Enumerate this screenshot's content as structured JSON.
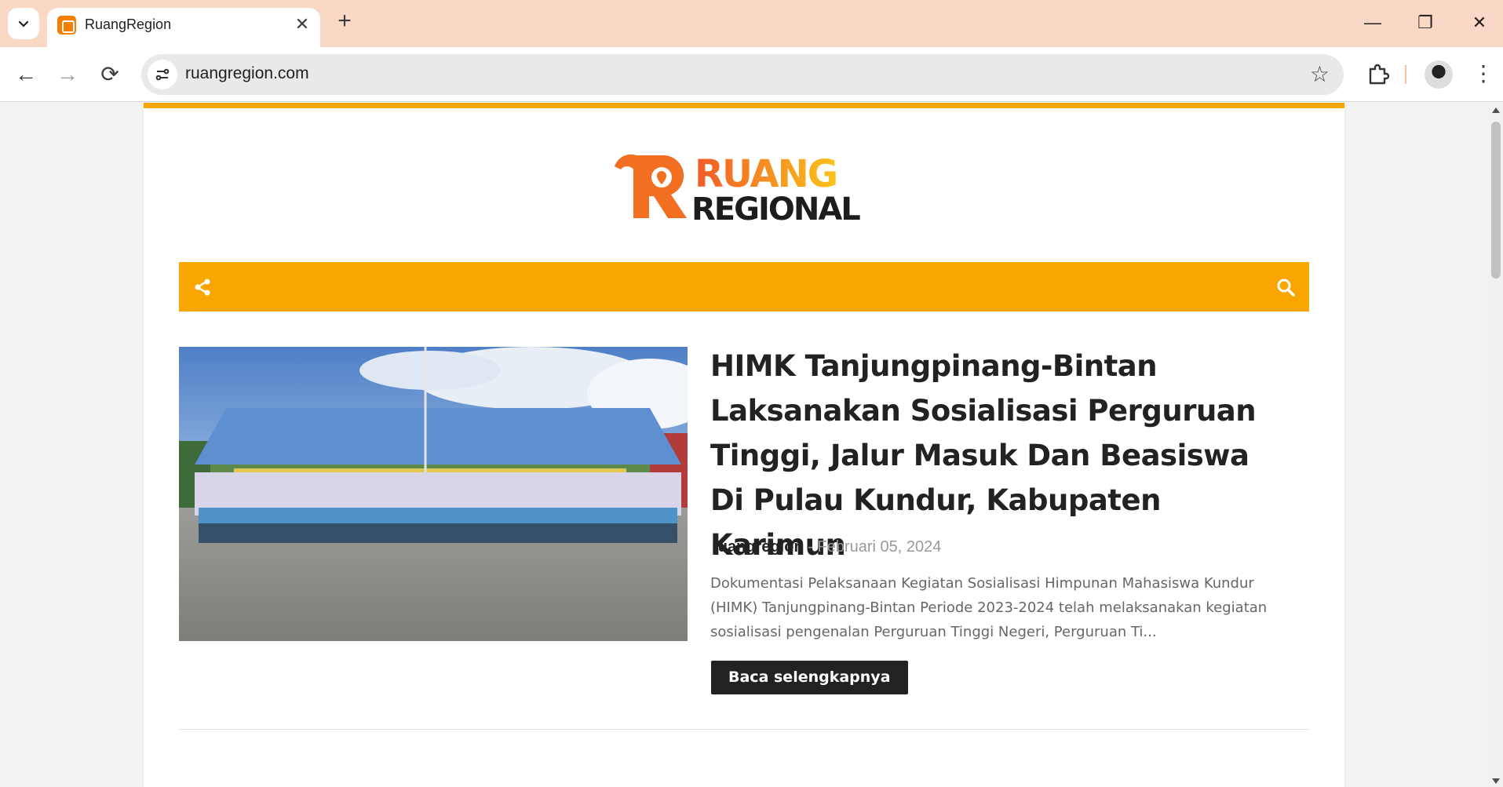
{
  "browser": {
    "tab_title": "RuangRegion",
    "url": "ruangregion.com",
    "new_tab_glyph": "+",
    "close_tab_glyph": "✕",
    "back_glyph": "←",
    "forward_glyph": "→",
    "reload_glyph": "⟳",
    "star_glyph": "☆",
    "menu_glyph": "⋮",
    "minimize_glyph": "—",
    "restore_glyph": "❐",
    "close_glyph": "✕"
  },
  "site": {
    "logo_top": "RUANG",
    "logo_bottom": "REGIONAL",
    "accent_color": "#f9a602"
  },
  "post": {
    "title": "HIMK Tanjungpinang-Bintan Laksanakan Sosialisasi Perguruan Tinggi, Jalur Masuk Dan Beasiswa Di Pulau Kundur, Kabupaten Karimun",
    "author": "ruangregion",
    "separator": " - ",
    "date": "Februari 05, 2024",
    "excerpt": "Dokumentasi Pelaksanaan Kegiatan Sosialisasi Himpunan Mahasiswa Kundur (HIMK) Tanjungpinang-Bintan Periode 2023-2024 telah melaksanakan kegiatan sosialisasi pengenalan Perguruan Tinggi Negeri, Perguruan Ti...",
    "read_more": "Baca selengkapnya"
  }
}
